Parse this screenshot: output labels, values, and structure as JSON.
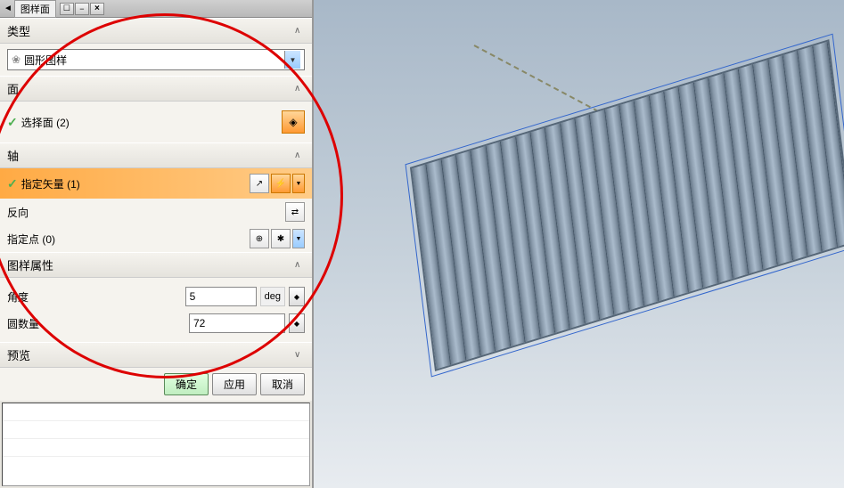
{
  "titlebar": {
    "tab_label": "图样面",
    "nav_back": "◄",
    "btn_windows": "☐",
    "btn_minimize": "−",
    "btn_close": "×"
  },
  "sections": {
    "type": {
      "label": "类型"
    },
    "face": {
      "label": "面"
    },
    "axis": {
      "label": "轴"
    },
    "pattern_props": {
      "label": "图样属性"
    },
    "preview": {
      "label": "预览"
    }
  },
  "type_dropdown": {
    "icon": "❀",
    "text": "圆形图样"
  },
  "face_row": {
    "label": "选择面 (2)"
  },
  "axis_rows": {
    "vector": {
      "label": "指定矢量 (1)"
    },
    "reverse": {
      "label": "反向"
    },
    "point": {
      "label": "指定点 (0)"
    }
  },
  "pattern_fields": {
    "angle": {
      "label": "角度",
      "value": "5",
      "unit": "deg"
    },
    "count": {
      "label": "圆数量",
      "value": "72"
    }
  },
  "buttons": {
    "ok": "确定",
    "apply": "应用",
    "cancel": "取消"
  },
  "icons": {
    "chevron_up": "∧",
    "chevron_down": "∨",
    "dropdown": "▼",
    "spin": "◆",
    "cube": "◈",
    "axis1": "↗",
    "axis2": "⚡",
    "swap": "⇄",
    "point1": "⊕",
    "point2": "✱"
  }
}
